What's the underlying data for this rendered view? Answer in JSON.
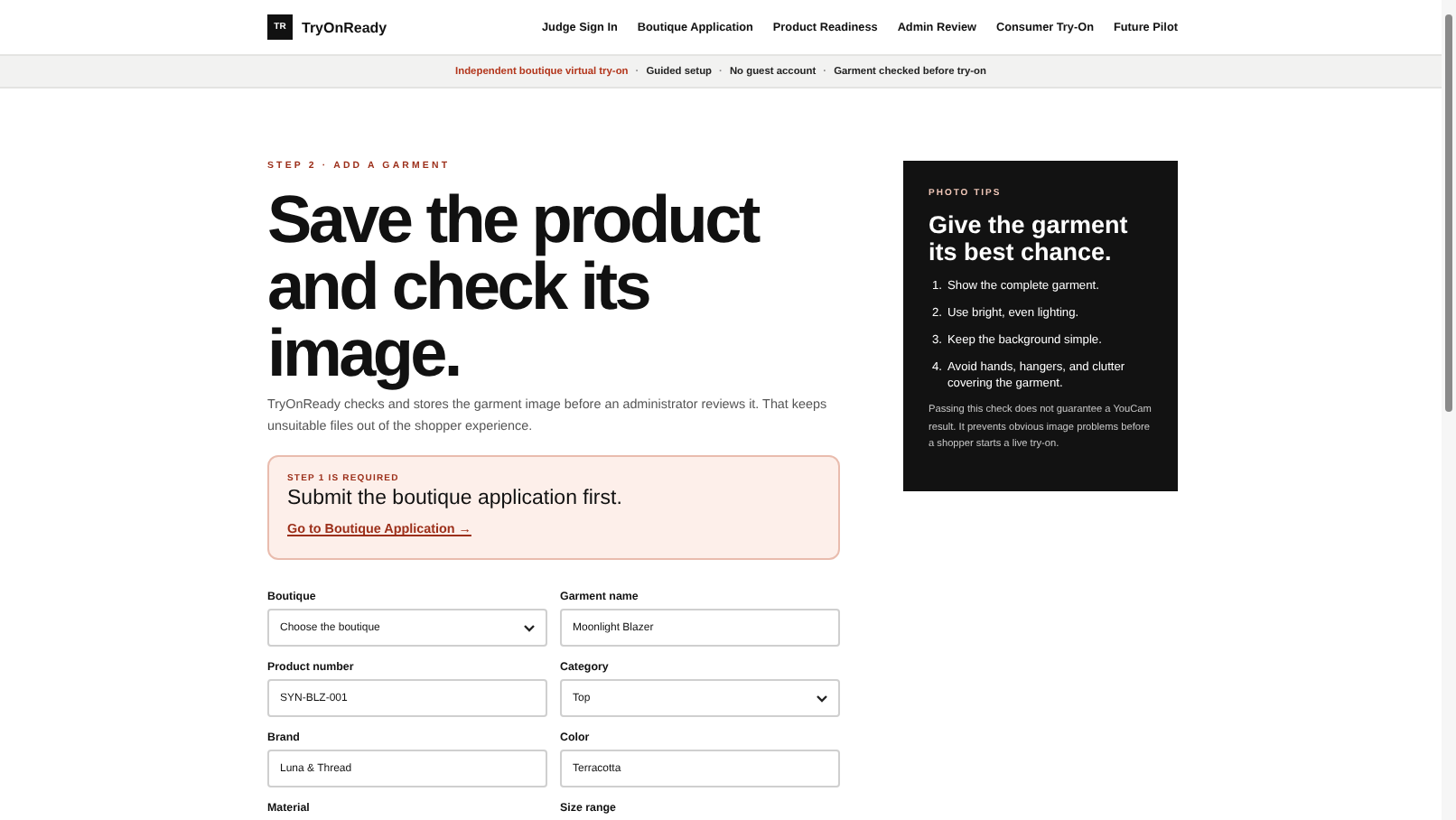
{
  "header": {
    "logo_mark": "TR",
    "brand": "TryOnReady",
    "nav": [
      {
        "label": "Judge Sign In"
      },
      {
        "label": "Boutique Application"
      },
      {
        "label": "Product Readiness"
      },
      {
        "label": "Admin Review"
      },
      {
        "label": "Consumer Try-On"
      },
      {
        "label": "Future Pilot"
      }
    ]
  },
  "banner": [
    {
      "kind": "highlight",
      "text": "Independent boutique virtual try-on"
    },
    {
      "kind": "sep",
      "text": "·"
    },
    {
      "kind": "plain",
      "text": "Guided setup"
    },
    {
      "kind": "sep",
      "text": "·"
    },
    {
      "kind": "plain",
      "text": "No guest account"
    },
    {
      "kind": "sep",
      "text": "·"
    },
    {
      "kind": "plain",
      "text": "Garment checked before try-on"
    }
  ],
  "main": {
    "eyebrow": "STEP 2 · ADD A GARMENT",
    "heading": "Save the product and check its image.",
    "intro": "TryOnReady checks and stores the garment image before an administrator reviews it. That keeps unsuitable files out of the shopper experience.",
    "alert": {
      "eyebrow": "STEP 1 IS REQUIRED",
      "title": "Submit the boutique application first.",
      "link": "Go to Boutique Application →"
    },
    "fields": [
      {
        "label": "Boutique",
        "kind": "select",
        "value": "Choose the boutique"
      },
      {
        "label": "Garment name",
        "kind": "input",
        "value": "Moonlight Blazer"
      },
      {
        "label": "Product number",
        "kind": "input",
        "value": "SYN-BLZ-001"
      },
      {
        "label": "Category",
        "kind": "select",
        "value": "Top"
      },
      {
        "label": "Brand",
        "kind": "input",
        "value": "Luna & Thread"
      },
      {
        "label": "Color",
        "kind": "input",
        "value": "Terracotta"
      },
      {
        "label": "Material"
      },
      {
        "label": "Size range"
      }
    ]
  },
  "tips": {
    "eyebrow": "PHOTO TIPS",
    "title": "Give the garment its best chance.",
    "items": [
      {
        "marker": "1.",
        "text": "Show the complete garment."
      },
      {
        "marker": "2.",
        "text": "Use bright, even lighting."
      },
      {
        "marker": "3.",
        "text": "Keep the background simple."
      },
      {
        "marker": "4.",
        "text": "Avoid hands, hangers, and clutter covering the garment."
      }
    ],
    "note": "Passing this check does not guarantee a YouCam result. It prevents obvious image problems before a shopper starts a live try-on."
  }
}
